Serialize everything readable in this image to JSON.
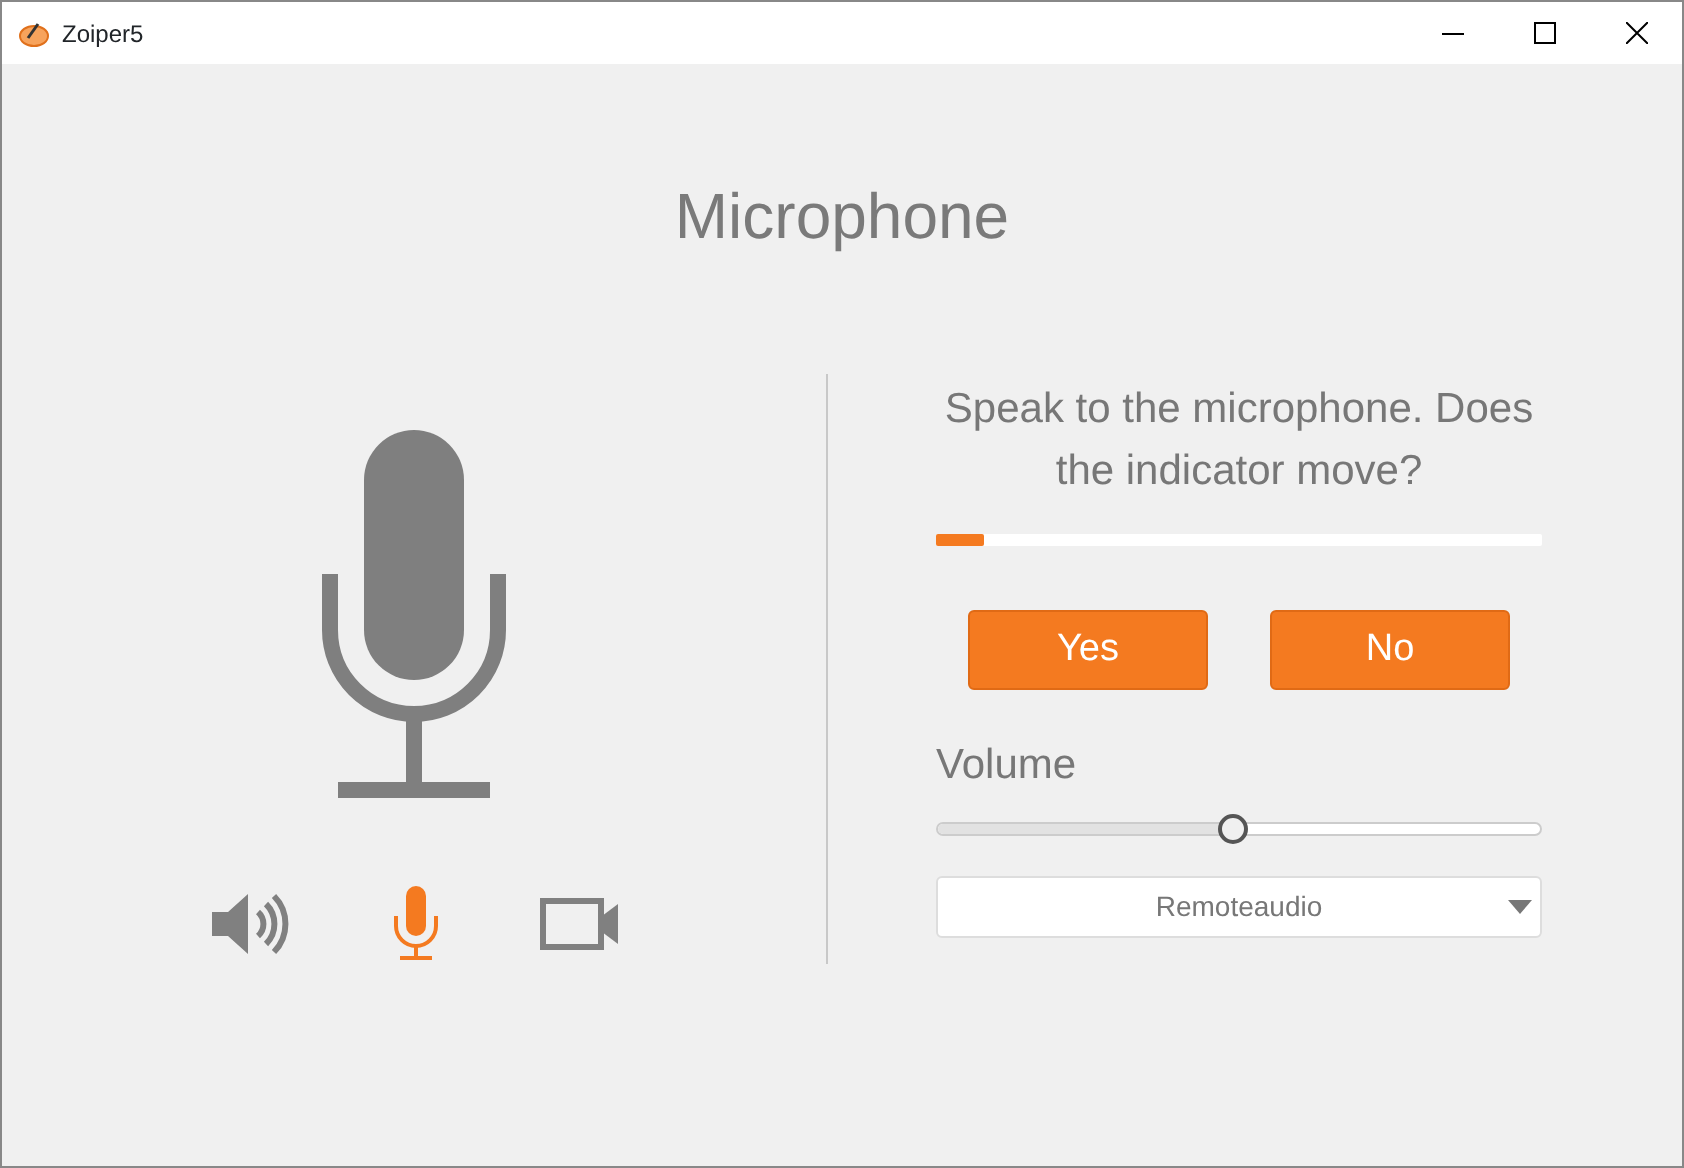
{
  "window": {
    "title": "Zoiper5"
  },
  "heading": "Microphone",
  "steps": [
    {
      "kind": "speaker",
      "selected": false
    },
    {
      "kind": "microphone",
      "selected": true
    },
    {
      "kind": "camera",
      "selected": false
    }
  ],
  "question": "Speak to the microphone. Does the indicator move?",
  "indicator": {
    "level": 0.08
  },
  "buttons": [
    "Yes",
    "No"
  ],
  "volume": {
    "label": "Volume",
    "level": 0.49
  },
  "device": {
    "value": "Remoteaudio"
  }
}
